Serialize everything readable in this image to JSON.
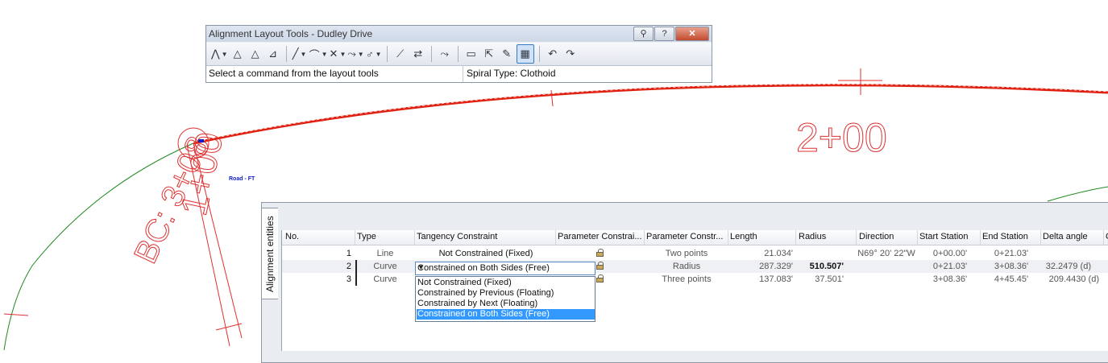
{
  "toolbar": {
    "title": "Alignment Layout Tools - Dudley Drive",
    "status_left": "Select a command from the layout tools",
    "status_right": "Spiral Type: Clothoid",
    "window_buttons": [
      "⚲",
      "?",
      "✕"
    ]
  },
  "drawing": {
    "station_2": "2+00",
    "station_1": "1+00",
    "curve_label": "BC: 3+08",
    "small_label": "Road - FT",
    "line_color": "#e02010",
    "green_color": "#1f8a1f"
  },
  "panel": {
    "tab_label": "Alignment entities",
    "columns": [
      "No.",
      "Type",
      "Tangency Constraint",
      "Parameter Constrai...",
      "Parameter Constr...",
      "Length",
      "Radius",
      "Direction",
      "Start Station",
      "End Station",
      "Delta angle",
      "C"
    ],
    "rows": [
      {
        "no": "1",
        "type": "Line",
        "tangency": "Not Constrained (Fixed)",
        "param": "Two points",
        "length": "21.034'",
        "radius": "",
        "direction": "N69° 20' 22\"W",
        "start": "0+00.00'",
        "end": "0+21.03'",
        "delta": ""
      },
      {
        "no": "2",
        "type": "Curve",
        "tangency": "Constrained on Both Sides (Free)",
        "param": "Radius",
        "length": "287.329'",
        "radius": "510.507'",
        "direction": "",
        "start": "0+21.03'",
        "end": "3+08.36'",
        "delta": "32.2479 (d)"
      },
      {
        "no": "3",
        "type": "Curve",
        "tangency": "",
        "param": "Three points",
        "length": "137.083'",
        "radius": "37.501'",
        "direction": "",
        "start": "3+08.36'",
        "end": "4+45.45'",
        "delta": "209.4430 (d)"
      }
    ],
    "dropdown_options": [
      "Not Constrained (Fixed)",
      "Constrained by Previous (Floating)",
      "Constrained by Next (Floating)",
      "Constrained on Both Sides (Free)"
    ],
    "dropdown_selected": "Constrained on Both Sides (Free)"
  }
}
